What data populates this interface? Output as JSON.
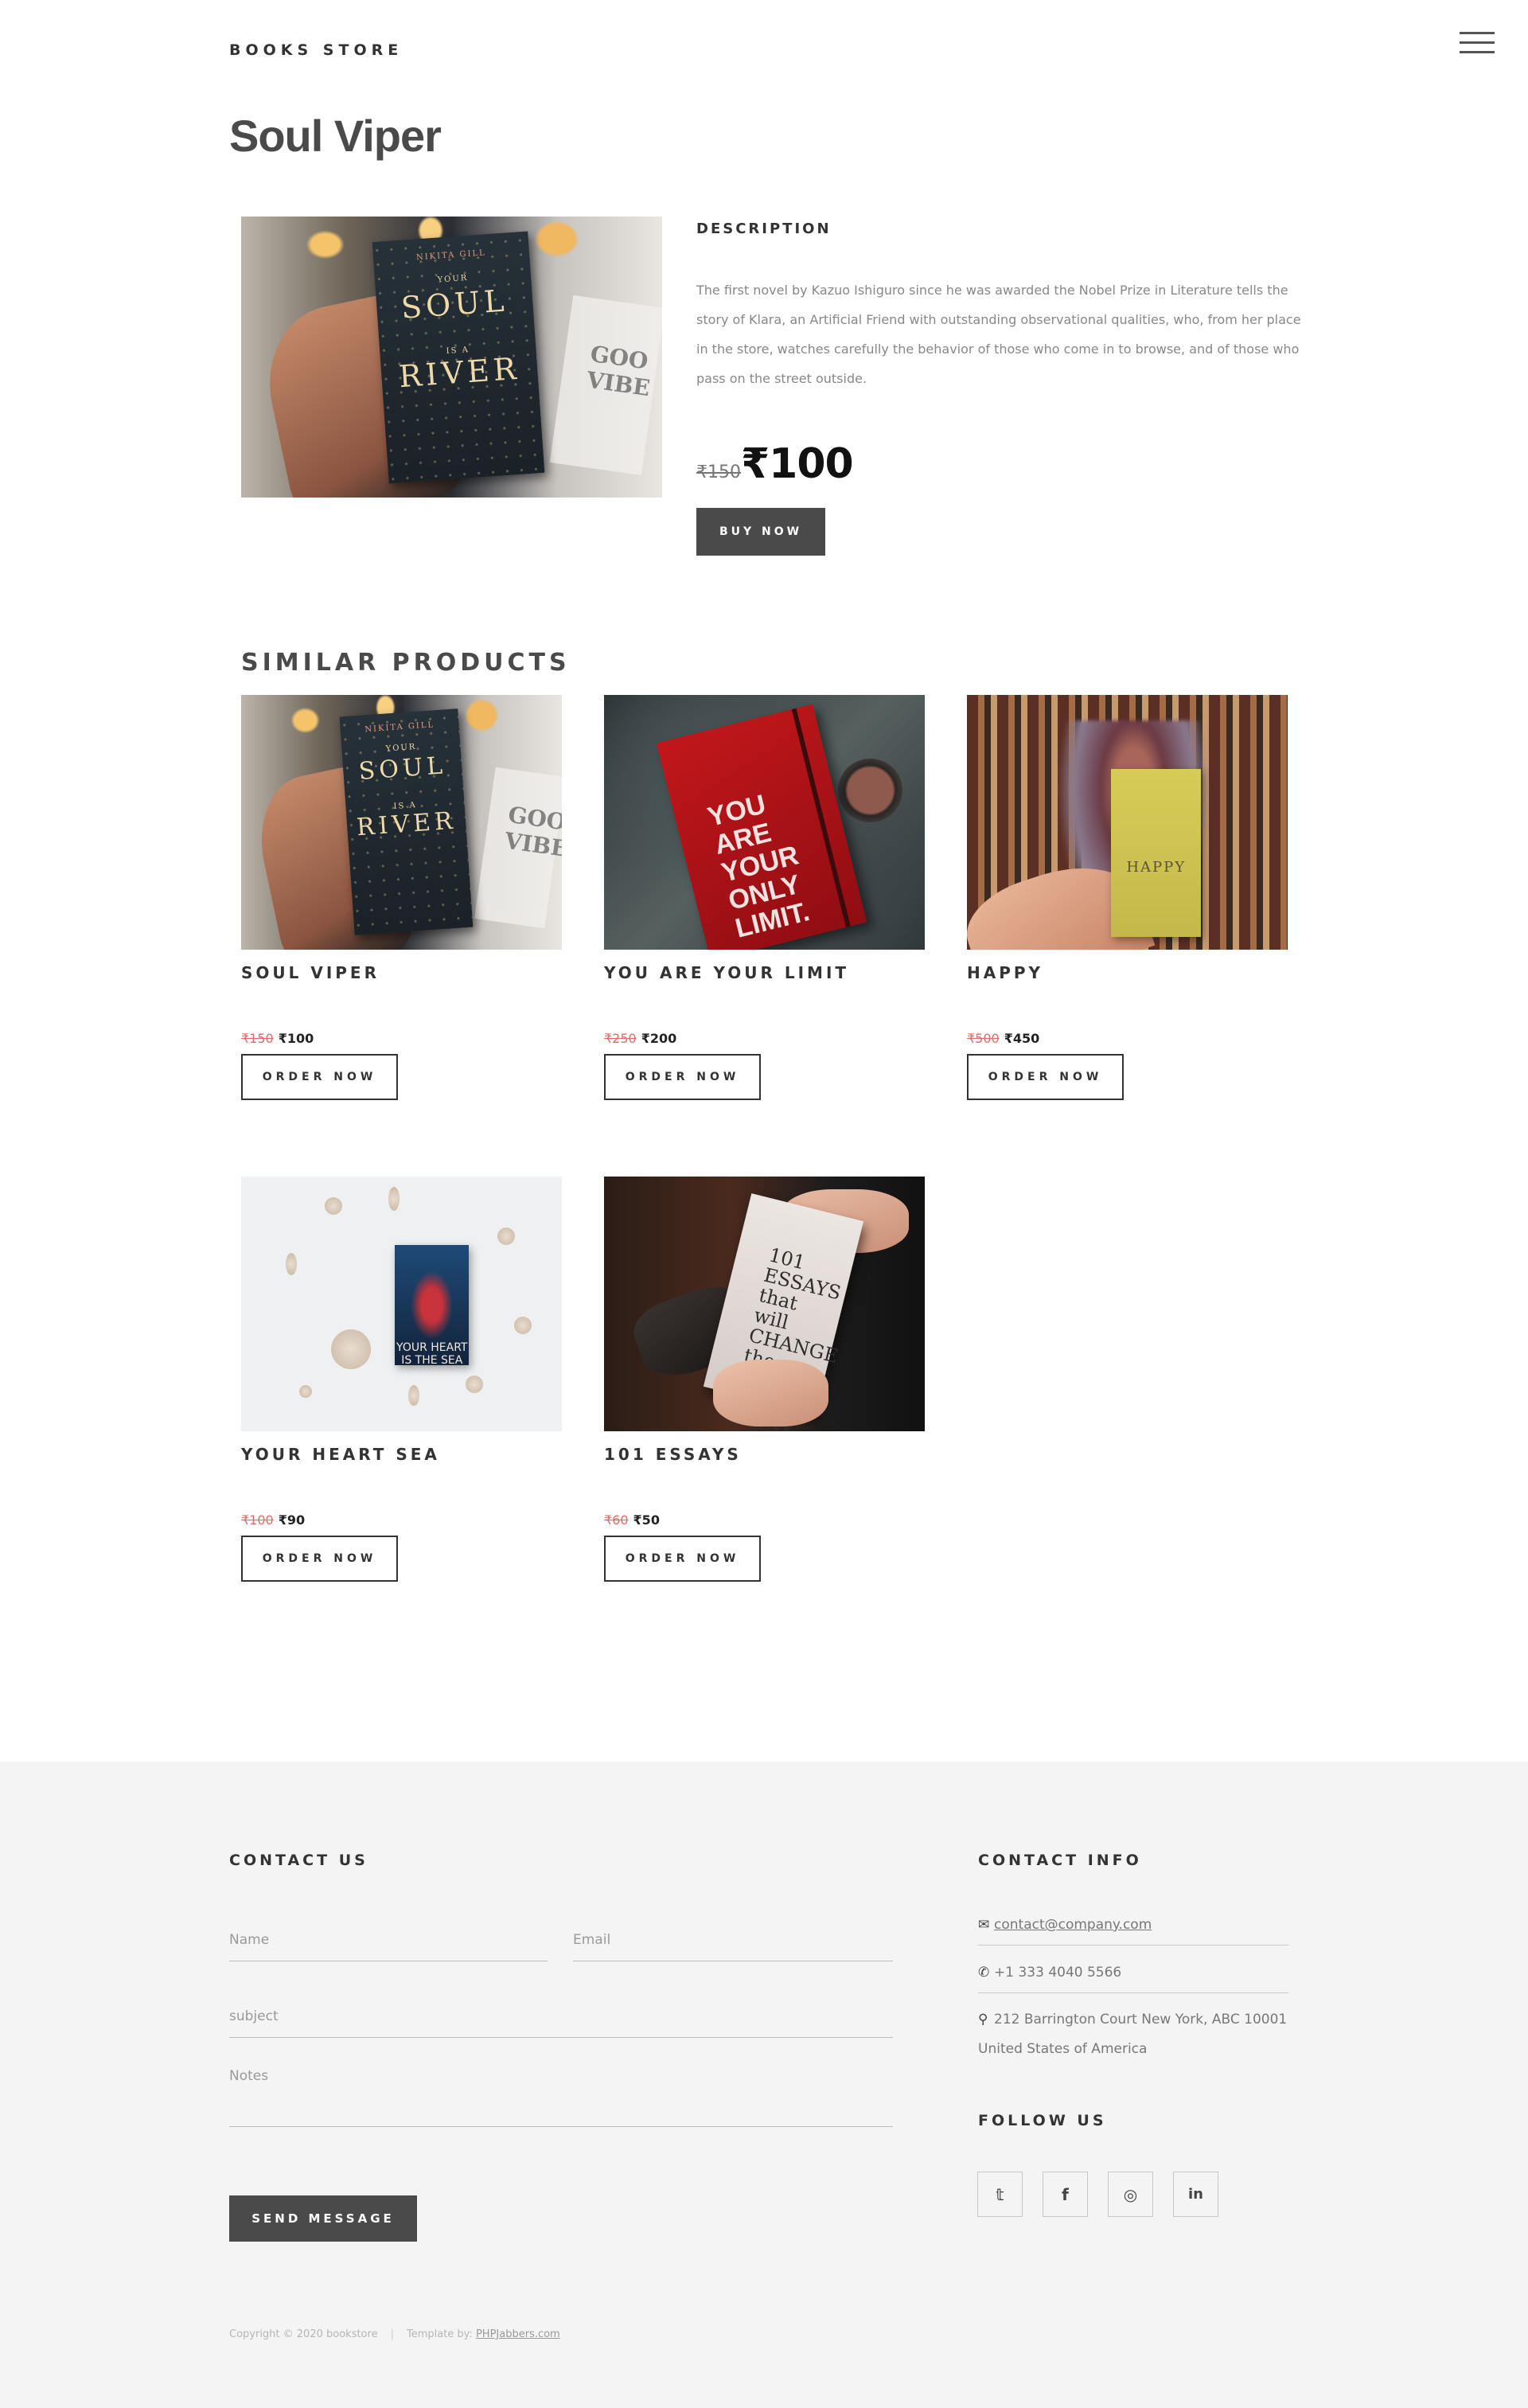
{
  "header": {
    "brand": "BOOKS STORE",
    "menu_icon": "hamburger-icon"
  },
  "product": {
    "title": "Soul Viper",
    "image_alt": "Soul is a River book",
    "description_heading": "DESCRIPTION",
    "description": "The first novel by Kazuo Ishiguro since he was awarded the Nobel Prize in Literature tells the story of Klara, an Artificial Friend with outstanding observational qualities, who, from her place in the store, watches carefully the behavior of those who come in to browse, and of those who pass on the street outside.",
    "old_price": "₹150",
    "new_price": "₹100",
    "buy_label": "BUY NOW"
  },
  "similar": {
    "heading": "SIMILAR PRODUCTS",
    "items": [
      {
        "title": "SOUL VIPER",
        "old_price": "₹150",
        "new_price": "₹100",
        "button": "ORDER NOW"
      },
      {
        "title": "YOU ARE YOUR LIMIT",
        "old_price": "₹250",
        "new_price": "₹200",
        "button": "ORDER NOW"
      },
      {
        "title": "HAPPY",
        "old_price": "₹500",
        "new_price": "₹450",
        "button": "ORDER NOW"
      },
      {
        "title": "YOUR HEART SEA",
        "old_price": "₹100",
        "new_price": "₹90",
        "button": "ORDER NOW"
      },
      {
        "title": "101 ESSAYS",
        "old_price": "₹60",
        "new_price": "₹50",
        "button": "ORDER NOW"
      }
    ]
  },
  "book_covers": {
    "soul": {
      "author": "NIKITA GILL",
      "line1": "YOUR",
      "line2": "SOUL",
      "line3": "IS A",
      "line4": "RIVER",
      "side": "GOO VIBE"
    },
    "limit": {
      "text": "YOU ARE YOUR ONLY LIMIT."
    },
    "happy": {
      "text": "HAPPY"
    },
    "heart": {
      "text": "YOUR HEART IS THE SEA"
    },
    "essays": {
      "text": "101 ESSAYS that will CHANGE the way YOU THINK"
    }
  },
  "contact": {
    "heading": "CONTACT US",
    "name_placeholder": "Name",
    "email_placeholder": "Email",
    "subject_placeholder": "subject",
    "notes_placeholder": "Notes",
    "send_label": "SEND MESSAGE"
  },
  "contact_info": {
    "heading": "CONTACT INFO",
    "email": "contact@company.com",
    "phone": "+1 333 4040 5566",
    "address_line1": "212 Barrington Court New York, ABC 10001",
    "address_line2": "United States of America"
  },
  "follow": {
    "heading": "FOLLOW US",
    "icons": [
      "twitter-icon",
      "facebook-icon",
      "instagram-icon",
      "linkedin-icon"
    ]
  },
  "footer": {
    "copyright": "Copyright © 2020 bookstore",
    "template_by": "Template by:",
    "template_link": "PHPJabbers.com"
  }
}
